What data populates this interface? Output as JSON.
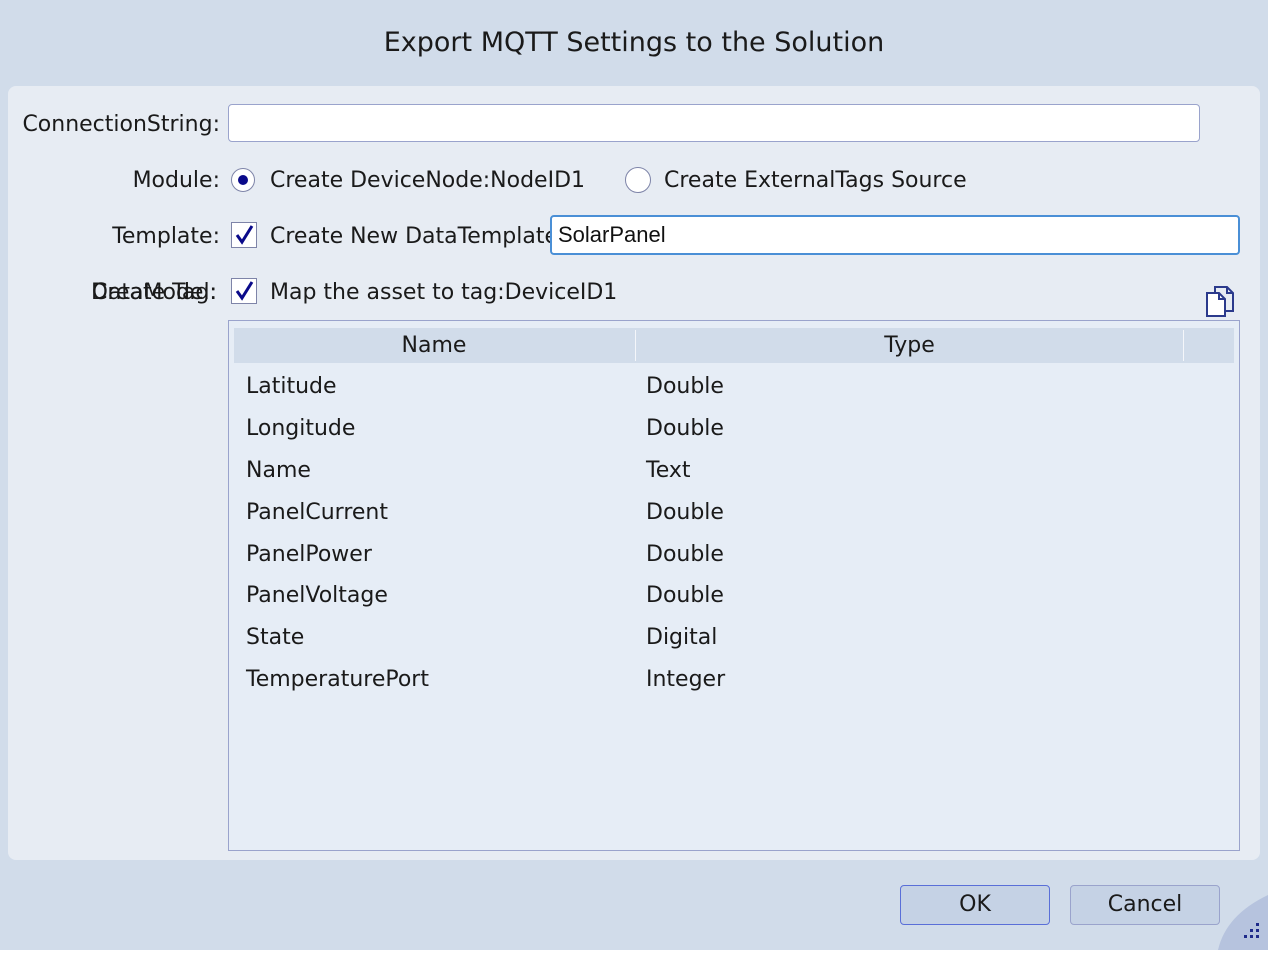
{
  "dialog": {
    "title": "Export MQTT Settings to the Solution"
  },
  "form": {
    "connection_string": {
      "label": "ConnectionString:",
      "value": ""
    },
    "module": {
      "label": "Module:",
      "options": [
        {
          "label": "Create DeviceNode:NodeID1",
          "selected": true
        },
        {
          "label": "Create ExternalTags Source",
          "selected": false
        }
      ]
    },
    "template": {
      "label": "Template:",
      "checkbox_label": "Create New DataTemplate:",
      "checked": true,
      "value": "SolarPanel"
    },
    "data_model": {
      "label_a": "DataModel:",
      "label_b": "Create Tag:",
      "checkbox_label": "Map the asset to tag:DeviceID1",
      "checked": true
    }
  },
  "icons": {
    "copy": "copy-document-icon",
    "check": "checkmark-icon",
    "grip": "resize-grip-icon"
  },
  "table": {
    "columns": [
      "Name",
      "Type"
    ],
    "rows": [
      {
        "name": "Latitude",
        "type": "Double"
      },
      {
        "name": "Longitude",
        "type": "Double"
      },
      {
        "name": "Name",
        "type": "Text"
      },
      {
        "name": "PanelCurrent",
        "type": "Double"
      },
      {
        "name": "PanelPower",
        "type": "Double"
      },
      {
        "name": "PanelVoltage",
        "type": "Double"
      },
      {
        "name": "State",
        "type": "Digital"
      },
      {
        "name": "TemperaturePort",
        "type": "Integer"
      }
    ]
  },
  "buttons": {
    "ok": "OK",
    "cancel": "Cancel"
  },
  "colors": {
    "window_bg": "#d1dcea",
    "panel_bg": "#e7ecf3",
    "accent": "#0a0a8a",
    "focus_border": "#4a8fd6"
  }
}
